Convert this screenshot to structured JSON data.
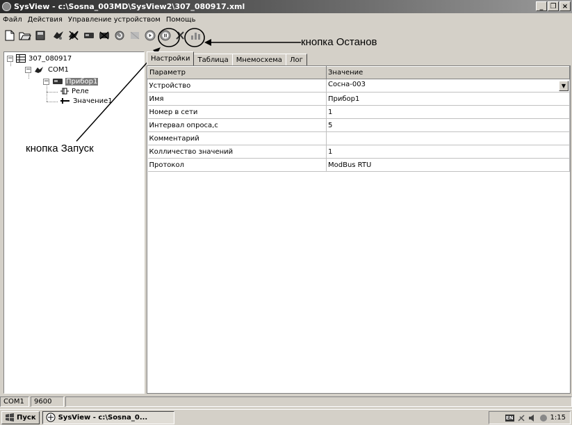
{
  "window": {
    "title": "SysView - c:\\Sosna_003MD\\SysView2\\307_080917.xml",
    "controls": [
      "_",
      "❐",
      "×"
    ]
  },
  "menu": [
    "Файл",
    "Действия",
    "Управление устройством",
    "Помощь"
  ],
  "toolbar": {
    "buttons": [
      "new-file-icon",
      "open-folder-icon",
      "save-icon",
      "add-port-icon",
      "delete-port-icon",
      "add-device-icon",
      "remove-device-icon",
      "refresh-icon",
      "disabled-icon",
      "start-icon",
      "stop-icon",
      "settings-icon",
      "chart-icon"
    ]
  },
  "tree": {
    "root": "307_080917",
    "port": "COM1",
    "device": "Прибор1",
    "relay": "Реле",
    "value": "Значение1"
  },
  "tabs": [
    "Настройки",
    "Таблица",
    "Мнемосхема",
    "Лог"
  ],
  "grid": {
    "headers": [
      "Параметр",
      "Значение"
    ],
    "rows": [
      [
        "Устройство",
        "Сосна-003"
      ],
      [
        "Имя",
        "Прибор1"
      ],
      [
        "Номер в сети",
        "1"
      ],
      [
        "Интервал опроса,с",
        "5"
      ],
      [
        "Комментарий",
        ""
      ],
      [
        "Колличество значений",
        "1"
      ],
      [
        "Протокол",
        "ModBus RTU"
      ]
    ]
  },
  "status": {
    "port": "COM1",
    "baud": "9600"
  },
  "taskbar": {
    "start": "Пуск",
    "task": "SysView - c:\\Sosna_0...",
    "lang": "EN",
    "clock": "1:15"
  },
  "annotations": {
    "stop": "кнопка Останов",
    "start": "кнопка Запуск"
  }
}
